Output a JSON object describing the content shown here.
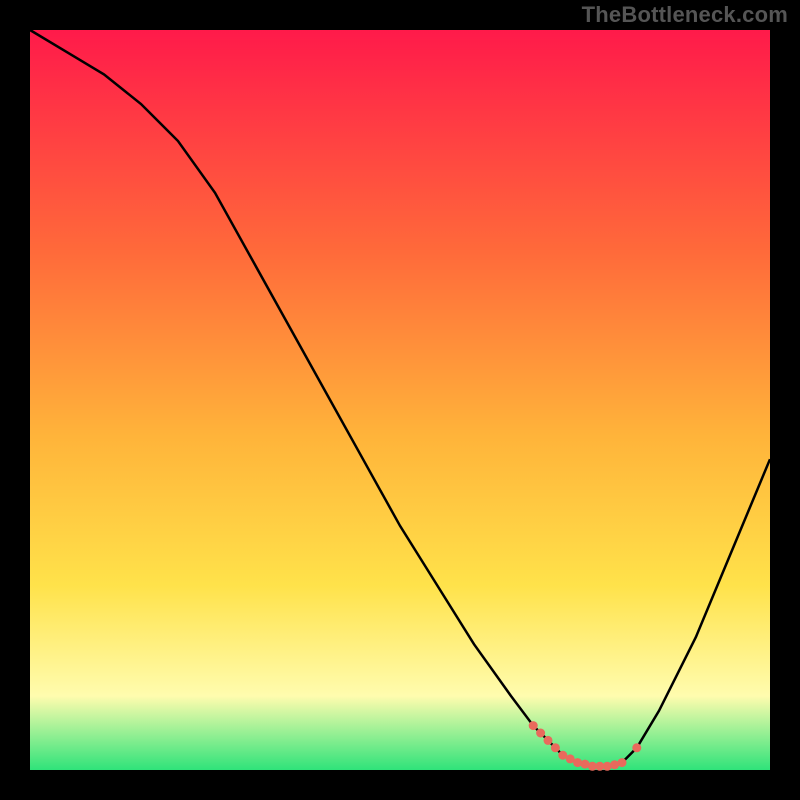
{
  "watermark": "TheBottleneck.com",
  "colors": {
    "background": "#000000",
    "curve": "#000000",
    "marker": "#e96a5c",
    "grad_top": "#ff1a4a",
    "grad_mid1": "#ff6a3a",
    "grad_mid2": "#ffb43a",
    "grad_mid3": "#ffe24a",
    "grad_mid4": "#fffcae",
    "grad_bottom": "#2fe37a"
  },
  "chart_data": {
    "type": "line",
    "title": "",
    "xlabel": "",
    "ylabel": "",
    "xlim": [
      0,
      100
    ],
    "ylim": [
      0,
      100
    ],
    "x": [
      0,
      5,
      10,
      15,
      20,
      25,
      30,
      35,
      40,
      45,
      50,
      55,
      60,
      65,
      68,
      70,
      72,
      74,
      76,
      78,
      80,
      82,
      85,
      90,
      95,
      100
    ],
    "values": [
      100,
      97,
      94,
      90,
      85,
      78,
      69,
      60,
      51,
      42,
      33,
      25,
      17,
      10,
      6,
      4,
      2,
      1,
      0.5,
      0.5,
      1,
      3,
      8,
      18,
      30,
      42
    ],
    "markers_x": [
      68,
      69,
      70,
      71,
      72,
      73,
      74,
      75,
      76,
      77,
      78,
      79,
      80,
      82
    ],
    "markers_y": [
      6,
      5,
      4,
      3,
      2,
      1.5,
      1,
      0.8,
      0.5,
      0.5,
      0.5,
      0.7,
      1,
      3
    ],
    "grid": false,
    "legend": false,
    "annotations": []
  }
}
